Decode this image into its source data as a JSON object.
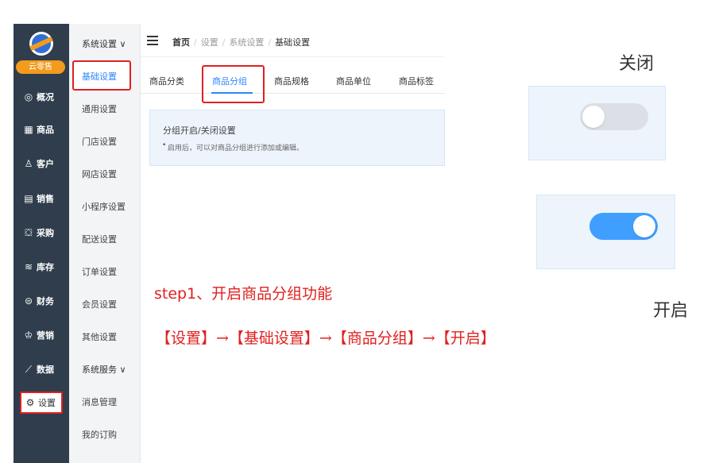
{
  "brand": {
    "name": "云零售"
  },
  "nav": {
    "items": [
      {
        "icon": "dashboard-icon",
        "glyph": "◎",
        "label": "概况"
      },
      {
        "icon": "grid-icon",
        "glyph": "▦",
        "label": "商品"
      },
      {
        "icon": "user-icon",
        "glyph": "♙",
        "label": "客户"
      },
      {
        "icon": "receipt-icon",
        "glyph": "▤",
        "label": "销售"
      },
      {
        "icon": "cart-icon",
        "glyph": "⛋",
        "label": "采购"
      },
      {
        "icon": "stack-icon",
        "glyph": "≋",
        "label": "库存"
      },
      {
        "icon": "money-icon",
        "glyph": "⊜",
        "label": "财务"
      },
      {
        "icon": "crown-icon",
        "glyph": "♔",
        "label": "营销"
      },
      {
        "icon": "chart-icon",
        "glyph": "⟋",
        "label": "数据"
      }
    ],
    "settings": {
      "icon": "gear-icon",
      "glyph": "⚙",
      "label": "设置"
    }
  },
  "subnav": {
    "group_system": "系统设置 ∨",
    "items": [
      "基础设置",
      "通用设置",
      "门店设置",
      "网店设置",
      "小程序设置",
      "配送设置",
      "订单设置",
      "会员设置",
      "其他设置"
    ],
    "group_service": "系统服务 ∨",
    "service_items": [
      "消息管理",
      "我的订购"
    ]
  },
  "breadcrumb": {
    "home": "首页",
    "a": "设置",
    "b": "系统设置",
    "current": "基础设置"
  },
  "tabs": [
    "商品分类",
    "商品分组",
    "商品规格",
    "商品单位",
    "商品标签"
  ],
  "panel": {
    "title": "分组开启/关闭设置",
    "desc": "启用后，可以对商品分组进行添加或编辑。"
  },
  "toggles": {
    "off_label": "关闭",
    "on_label": "开启",
    "off_state": false,
    "on_state": true
  },
  "colors": {
    "accent": "#2e86ff",
    "annotation": "#e02020",
    "nav_bg": "#2f3d4c",
    "toggle_off": "#dcdfe6",
    "toggle_on": "#409eff"
  },
  "annotation": {
    "step": "step1、开启商品分组功能",
    "path": "【设置】→【基础设置】→【商品分组】→【开启】"
  }
}
